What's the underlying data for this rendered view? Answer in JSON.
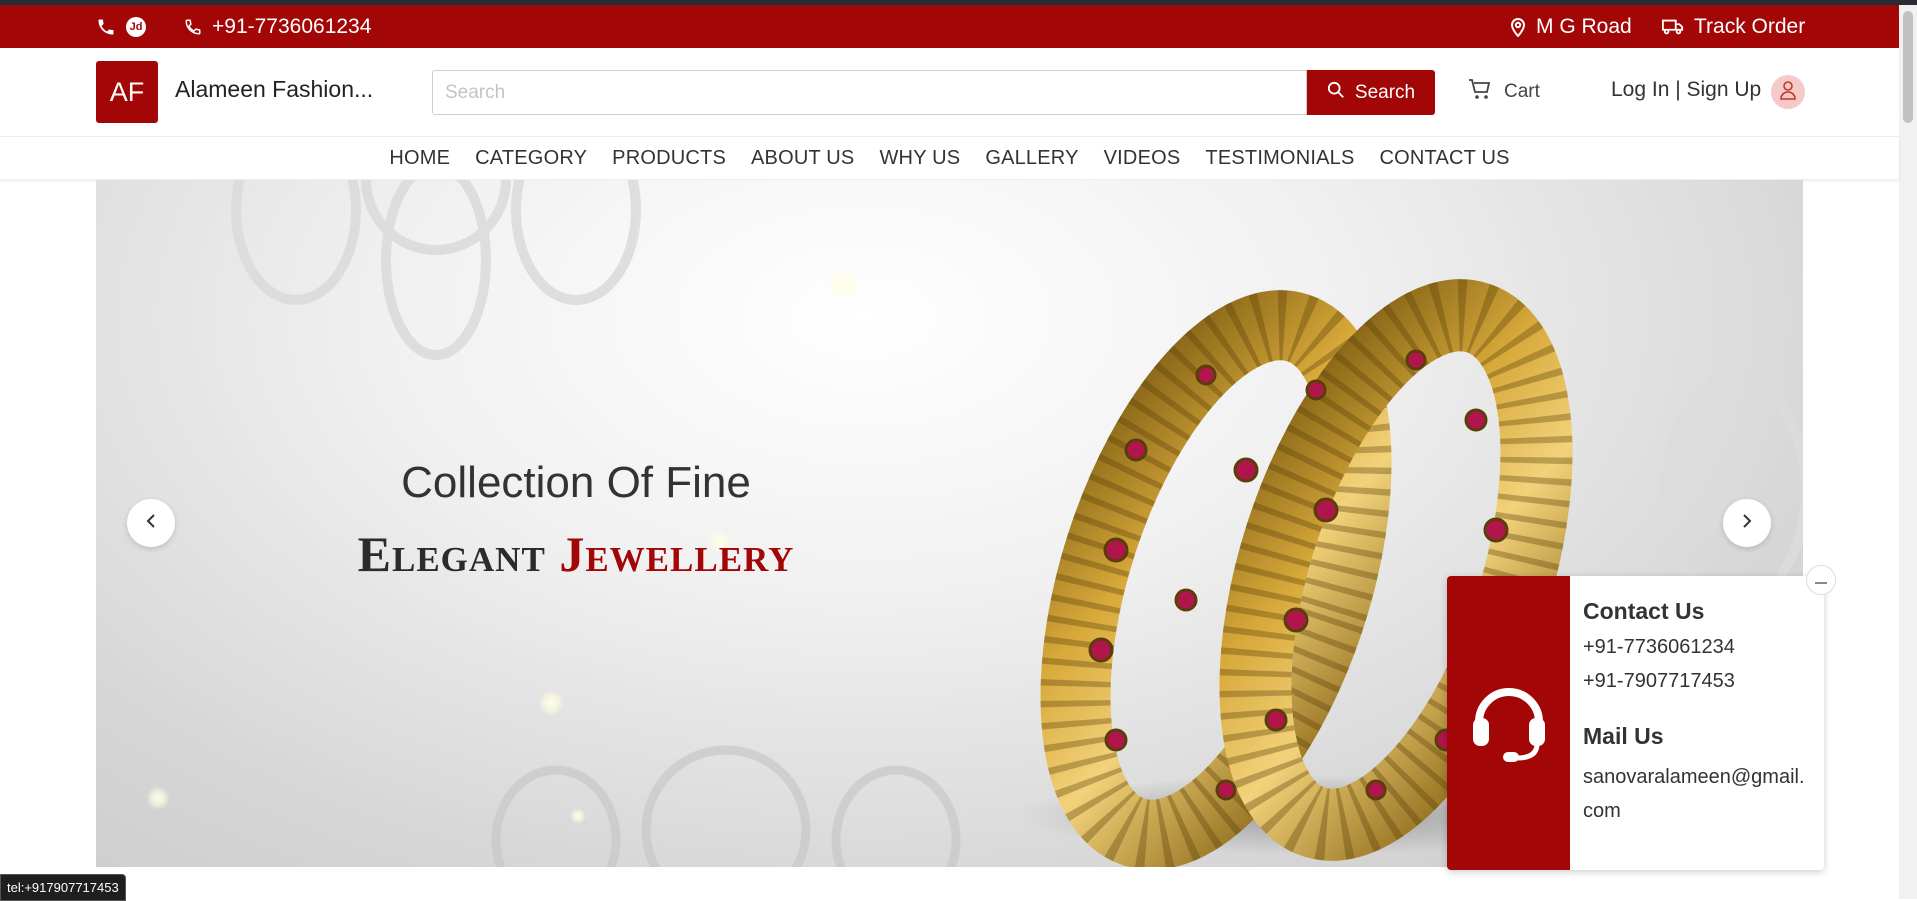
{
  "topbar": {
    "phone": "+91-7736061234",
    "jd_label": "Jd",
    "location": "M G Road",
    "track_order": "Track Order"
  },
  "header": {
    "logo_initials": "AF",
    "store_name": "Alameen Fashion...",
    "search_placeholder": "Search",
    "search_button": "Search",
    "cart_label": "Cart",
    "login_label": "Log In | Sign Up"
  },
  "nav": {
    "items": [
      "HOME",
      "CATEGORY",
      "PRODUCTS",
      "ABOUT US",
      "WHY US",
      "GALLERY",
      "VIDEOS",
      "TESTIMONIALS",
      "CONTACT US"
    ]
  },
  "hero": {
    "line1": "Collection Of Fine",
    "line2_a": "Elegant",
    "line2_b": "Jewellery"
  },
  "contact_card": {
    "contact_title": "Contact Us",
    "phone1": "+91-7736061234",
    "phone2": "+91-7907717453",
    "mail_title": "Mail Us",
    "email": "sanovaralameen@gmail.com"
  },
  "status_tip": "tel:+917907717453",
  "colors": {
    "brand_red": "#a30606",
    "topbar": "#a30606"
  }
}
